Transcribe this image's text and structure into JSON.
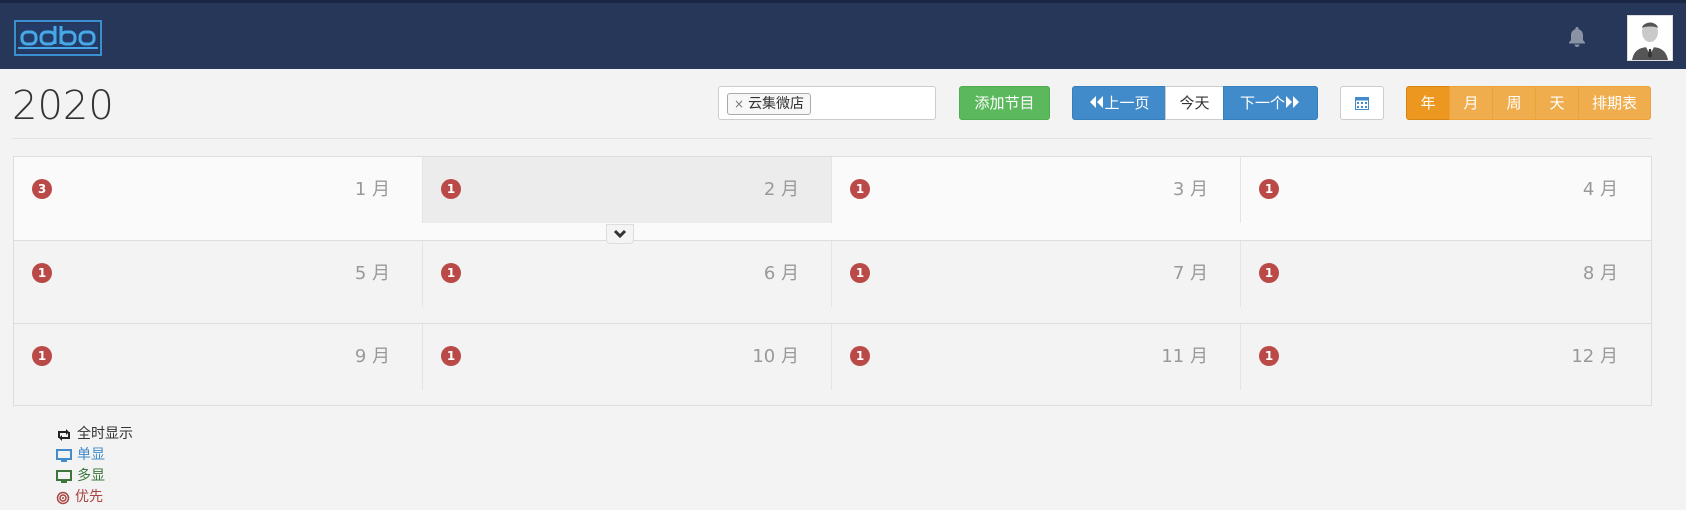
{
  "header": {
    "logo_icon": "logo",
    "bell_icon": "bell-icon",
    "avatar_icon": "user-avatar"
  },
  "calendar": {
    "year_title": "2020"
  },
  "filter": {
    "tag_remove": "×",
    "tag_label": "云集微店"
  },
  "toolbar": {
    "add_label": "添加节目",
    "prev_label": "上一页",
    "today_label": "今天",
    "next_label": "下一个",
    "calendar_icon": "calendar-icon",
    "views": [
      "年",
      "月",
      "周",
      "天",
      "排期表"
    ],
    "active_view": "年"
  },
  "months": [
    {
      "label": "1 月",
      "count": "3"
    },
    {
      "label": "2 月",
      "count": "1"
    },
    {
      "label": "3 月",
      "count": "1"
    },
    {
      "label": "4 月",
      "count": "1"
    },
    {
      "label": "5 月",
      "count": "1"
    },
    {
      "label": "6 月",
      "count": "1"
    },
    {
      "label": "7 月",
      "count": "1"
    },
    {
      "label": "8 月",
      "count": "1"
    },
    {
      "label": "9 月",
      "count": "1"
    },
    {
      "label": "10 月",
      "count": "1"
    },
    {
      "label": "11 月",
      "count": "1"
    },
    {
      "label": "12 月",
      "count": "1"
    }
  ],
  "legend": {
    "all_time": "全时显示",
    "single": "单显",
    "multi": "多显",
    "priority": "优先"
  },
  "colors": {
    "header_bg": "#26375a",
    "badge": "#b94a48",
    "single": "#428bca",
    "multi": "#3c763d",
    "priority": "#a94442"
  }
}
